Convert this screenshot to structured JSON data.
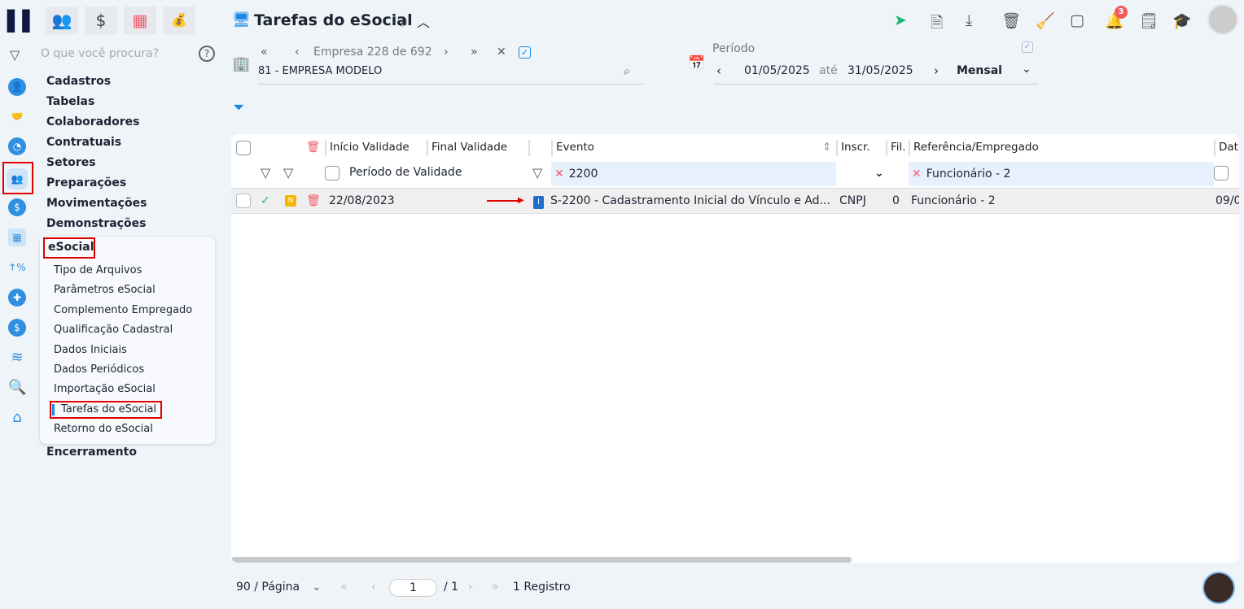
{
  "header": {
    "title": "Tarefas do eSocial"
  },
  "sidebar": {
    "search_placeholder": "O que você procura?",
    "items": [
      "Cadastros",
      "Tabelas",
      "Colaboradores",
      "Contratuais",
      "Setores",
      "Preparações",
      "Movimentações",
      "Demonstrações"
    ],
    "esocial": {
      "label": "eSocial",
      "items": [
        "Tipo de Arquivos",
        "Parâmetros eSocial",
        "Complemento Empregado",
        "Qualificação Cadastral",
        "Dados Iniciais",
        "Dados Periódicos",
        "Importação eSocial",
        "Tarefas do eSocial",
        "Retorno do eSocial"
      ]
    },
    "last": "Encerramento"
  },
  "company": {
    "nav": "Empresa 228 de 692",
    "value": "81 - EMPRESA MODELO"
  },
  "period": {
    "label": "Período",
    "from": "01/05/2025",
    "sep": "até",
    "to": "31/05/2025",
    "mode": "Mensal"
  },
  "notifications": {
    "count": "3"
  },
  "table": {
    "headers": {
      "inicio": "Início Validade",
      "final": "Final Validade",
      "evento": "Evento",
      "inscr": "Inscr.",
      "fil": "Fil.",
      "ref": "Referência/Empregado",
      "dat": "Dat"
    },
    "filters": {
      "periodo": "Período de Validade",
      "evento": "2200",
      "ref": "Funcionário - 2"
    },
    "rows": [
      {
        "badge": "N",
        "inicio": "22/08/2023",
        "tipo": "I",
        "evento": "S-2200 - Cadastramento Inicial do Vínculo e Ad...",
        "inscr": "CNPJ",
        "fil": "0",
        "ref": "Funcionário - 2",
        "dat": "09/0"
      }
    ]
  },
  "pagination": {
    "per_page": "90 / Página",
    "page": "1",
    "total_pages": "/ 1",
    "records": "1 Registro"
  },
  "colors": {
    "accent": "#1e88e5",
    "highlight": "#e00000"
  }
}
